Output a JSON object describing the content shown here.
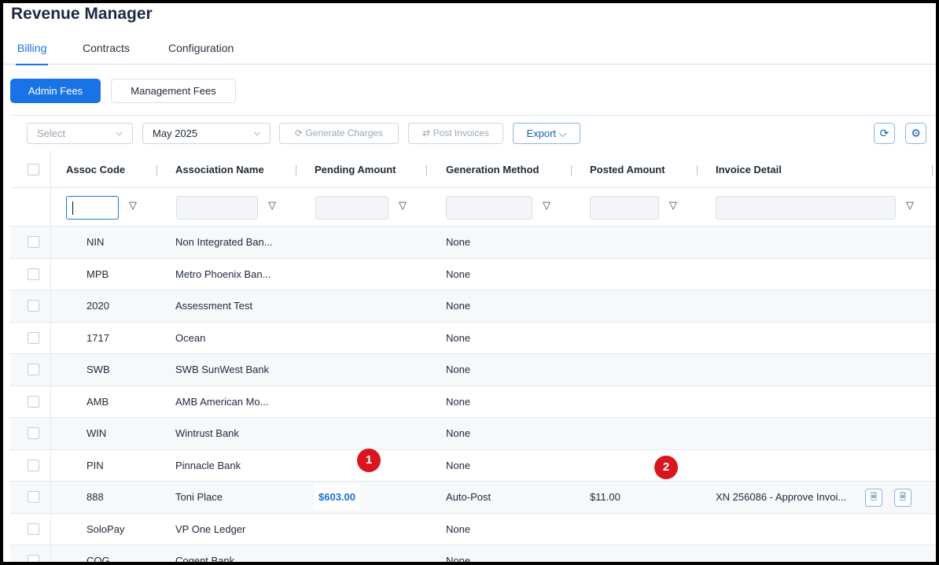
{
  "app": {
    "title": "Revenue Manager"
  },
  "tabs": [
    {
      "label": "Billing",
      "active": true
    },
    {
      "label": "Contracts",
      "active": false
    },
    {
      "label": "Configuration",
      "active": false
    }
  ],
  "subtabs": [
    {
      "label": "Admin Fees",
      "active": true
    },
    {
      "label": "Management Fees",
      "active": false
    }
  ],
  "toolbar": {
    "select_placeholder": "Select",
    "month_value": "May 2025",
    "generate_label": "Generate Charges",
    "post_label": "Post Invoices",
    "export_label": "Export",
    "chevron": "⌵",
    "refresh_glyph": "⟳",
    "settings_glyph": "⚙"
  },
  "columns": [
    "Assoc Code",
    "Association Name",
    "Pending Amount",
    "Generation Method",
    "Posted Amount",
    "Invoice Detail"
  ],
  "filter_glyph": "▽",
  "rows": [
    {
      "code": "NIN",
      "name": "Non Integrated Ban...",
      "pending": "",
      "method": "None",
      "posted": "",
      "detail": ""
    },
    {
      "code": "MPB",
      "name": "Metro Phoenix Ban...",
      "pending": "",
      "method": "None",
      "posted": "",
      "detail": ""
    },
    {
      "code": "2020",
      "name": "Assessment Test",
      "pending": "",
      "method": "None",
      "posted": "",
      "detail": ""
    },
    {
      "code": "1717",
      "name": "Ocean",
      "pending": "",
      "method": "None",
      "posted": "",
      "detail": ""
    },
    {
      "code": "SWB",
      "name": "SWB SunWest Bank",
      "pending": "",
      "method": "None",
      "posted": "",
      "detail": ""
    },
    {
      "code": "AMB",
      "name": "AMB American Mo...",
      "pending": "",
      "method": "None",
      "posted": "",
      "detail": ""
    },
    {
      "code": "WIN",
      "name": "Wintrust Bank",
      "pending": "",
      "method": "None",
      "posted": "",
      "detail": ""
    },
    {
      "code": "PIN",
      "name": "Pinnacle Bank",
      "pending": "",
      "method": "None",
      "posted": "",
      "detail": ""
    },
    {
      "code": "888",
      "name": "Toni Place",
      "pending": "$603.00",
      "method": "Auto-Post",
      "posted": "$11.00",
      "detail": "XN 256086 - Approve Invoi..."
    },
    {
      "code": "SoloPay",
      "name": "VP One Ledger",
      "pending": "",
      "method": "None",
      "posted": "",
      "detail": ""
    },
    {
      "code": "COG",
      "name": "Cogent Bank",
      "pending": "",
      "method": "None",
      "posted": "",
      "detail": ""
    }
  ],
  "doc_icons": {
    "pdf": "🗎",
    "excel": "🗎"
  },
  "annotations": [
    "1",
    "2"
  ],
  "colors": {
    "accent": "#1873e6",
    "badge": "#d9161f",
    "title": "#1e2a44"
  }
}
